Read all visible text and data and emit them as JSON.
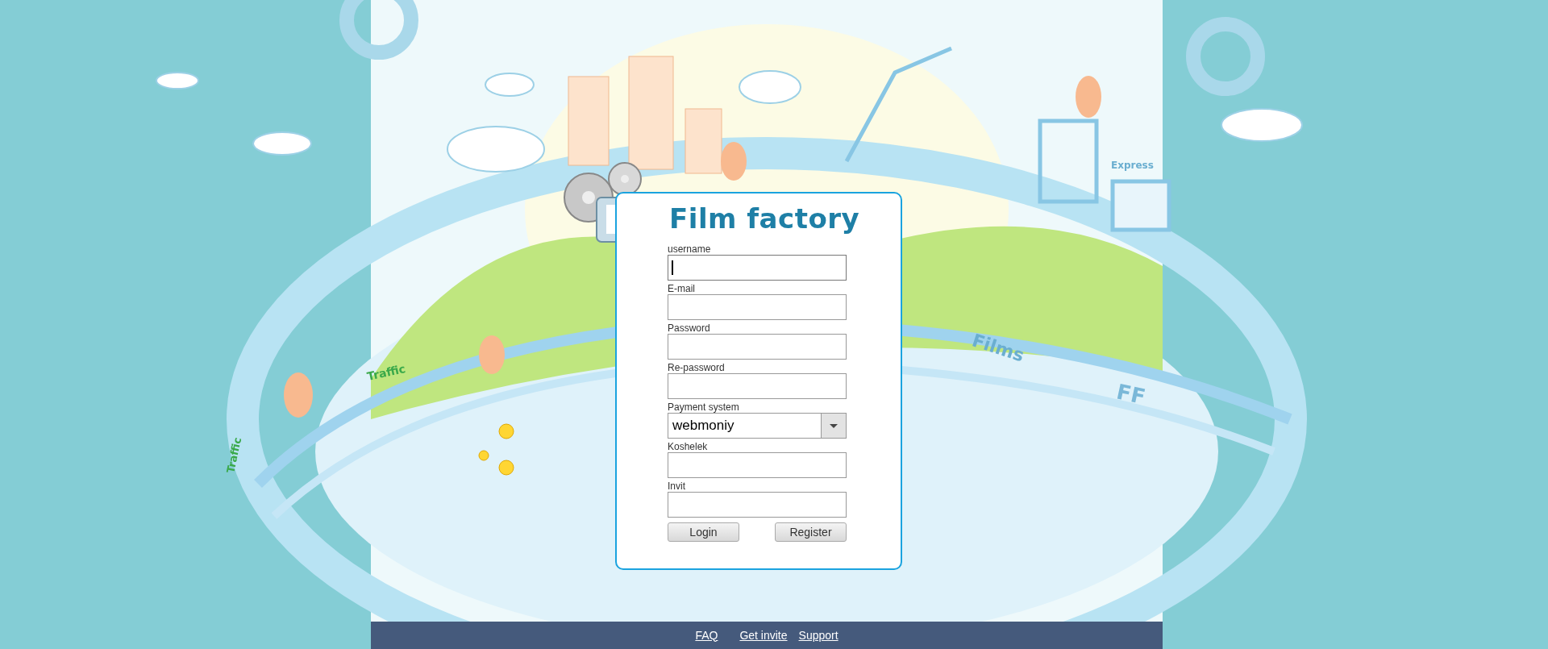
{
  "title": "Film factory",
  "fields": [
    {
      "label": "username",
      "kind": "text",
      "focused": true
    },
    {
      "label": "E-mail",
      "kind": "text",
      "focused": false
    },
    {
      "label": "Password",
      "kind": "password",
      "focused": false
    },
    {
      "label": "Re-password",
      "kind": "password",
      "focused": false
    },
    {
      "label": "Payment system",
      "kind": "select",
      "value": "webmoniy",
      "focused": false
    },
    {
      "label": "Koshelek",
      "kind": "text",
      "focused": false
    },
    {
      "label": "Invit",
      "kind": "text",
      "focused": false
    }
  ],
  "buttons": [
    "Login",
    "Register"
  ],
  "footer_links": [
    "FAQ",
    "Get invite",
    "Support"
  ],
  "artwork_labels": [
    "Traffic",
    "Traffic",
    "Films",
    "FF",
    "Express"
  ]
}
